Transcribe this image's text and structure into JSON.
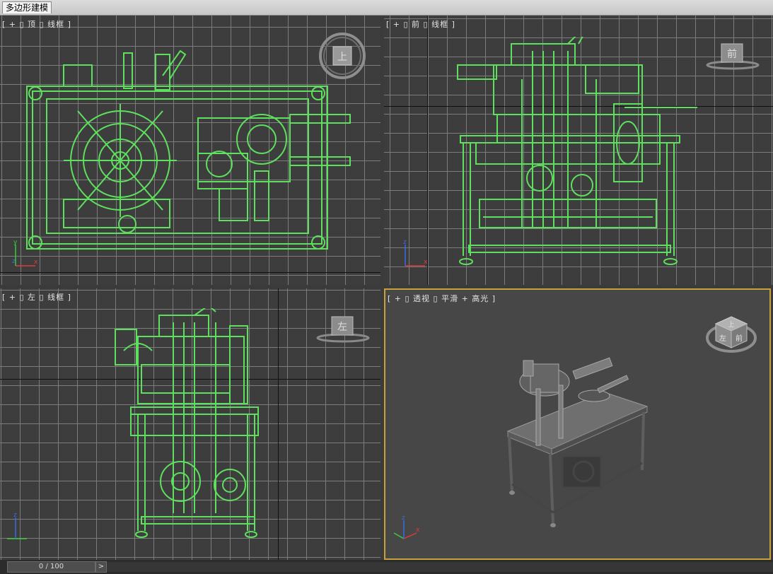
{
  "ribbon": {
    "tab_label": "多边形建模"
  },
  "viewports": {
    "top": {
      "label": "[ + ▯ 顶 ▯ 线框 ]",
      "cube_face": "上"
    },
    "front": {
      "label": "[ + ▯ 前 ▯ 线框 ]",
      "cube_face": "前"
    },
    "left": {
      "label": "[ + ▯ 左 ▯ 线框 ]",
      "cube_face": "左"
    },
    "perspective": {
      "label": "[ + ▯ 透视 ▯ 平滑 + 高光 ]",
      "cube_face_a": "上",
      "cube_face_b": "左",
      "cube_face_c": "前"
    }
  },
  "axis_labels": {
    "x": "x",
    "y": "y",
    "z": "z"
  },
  "timeline": {
    "frame_readout": "0 / 100",
    "next_button": ">"
  },
  "colors": {
    "wireframe": "#5ee05e",
    "grid": "#7c7c7c",
    "viewport_bg": "#3d3d3d",
    "active_border": "#c7a23b",
    "x_axis": "#e23a3a",
    "y_axis": "#3acb3a",
    "z_axis": "#3a6be2"
  }
}
